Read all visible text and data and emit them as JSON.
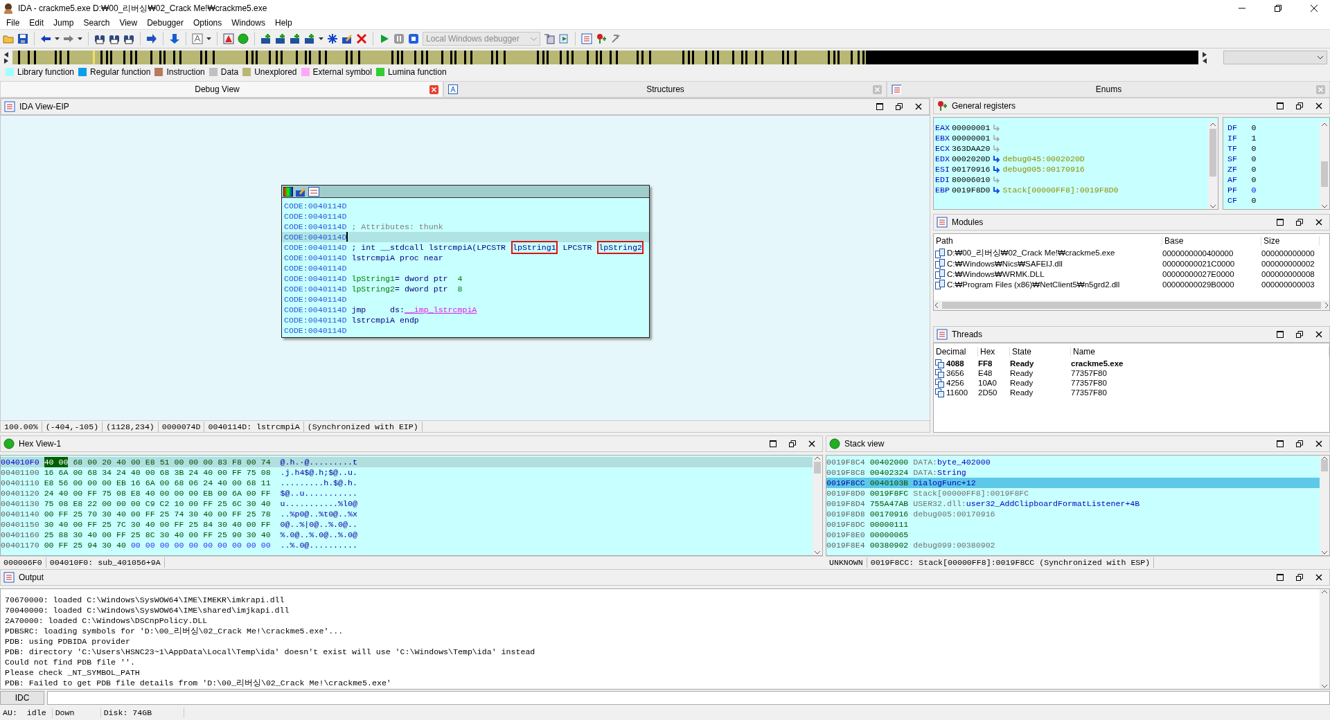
{
  "window": {
    "title": "IDA - crackme5.exe D:₩00_리버싱₩02_Crack Me!₩crackme5.exe"
  },
  "menu": [
    "File",
    "Edit",
    "Jump",
    "Search",
    "View",
    "Debugger",
    "Options",
    "Windows",
    "Help"
  ],
  "toolbar": {
    "debugger": {
      "value": "Local Windows debugger",
      "disabled": true
    }
  },
  "legend": [
    {
      "label": "Library function",
      "color": "#a0ffff"
    },
    {
      "label": "Regular function",
      "color": "#0c9ee6"
    },
    {
      "label": "Instruction",
      "color": "#b57b5c"
    },
    {
      "label": "Data",
      "color": "#c0c0c0"
    },
    {
      "label": "Unexplored",
      "color": "#b8b874"
    },
    {
      "label": "External symbol",
      "color": "#ffa8f8"
    },
    {
      "label": "Lumina function",
      "color": "#33cc33"
    }
  ],
  "tabs": [
    {
      "label": "Debug View",
      "selected": true
    },
    {
      "label": "Structures",
      "selected": false
    },
    {
      "label": "Enums",
      "selected": false
    }
  ],
  "ida_view": {
    "title": "IDA View-EIP",
    "popup": {
      "lines": [
        {
          "address": "CODE:0040114D",
          "selected": false
        },
        {
          "address": "CODE:0040114D",
          "selected": false
        },
        {
          "address": "CODE:0040114D",
          "selected": false,
          "parts": [
            {
              "text": "; Attributes: thunk",
              "kind": "comment"
            }
          ]
        },
        {
          "address": "CODE:0040114D",
          "selected": true
        },
        {
          "address": "CODE:0040114D",
          "selected": false,
          "parts": [
            {
              "text": "; int __stdcall lstrcmpiA(LPCSTR ",
              "kind": "code"
            },
            {
              "text": "lpString1",
              "kind": "boxed"
            },
            {
              "text": " LPCSTR ",
              "kind": "code"
            },
            {
              "text": "lpString2",
              "kind": "boxed"
            }
          ]
        },
        {
          "address": "CODE:0040114D",
          "selected": false,
          "parts": [
            {
              "text": "lstrcmpiA proc near",
              "kind": "code"
            }
          ]
        },
        {
          "address": "CODE:0040114D",
          "selected": false
        },
        {
          "address": "CODE:0040114D",
          "selected": false,
          "parts": [
            {
              "text": "lpString1",
              "kind": "name"
            },
            {
              "text": "= dword ptr  ",
              "kind": "code"
            },
            {
              "text": "4",
              "kind": "number"
            }
          ]
        },
        {
          "address": "CODE:0040114D",
          "selected": false,
          "parts": [
            {
              "text": "lpString2",
              "kind": "name"
            },
            {
              "text": "= dword ptr  ",
              "kind": "code"
            },
            {
              "text": "8",
              "kind": "number"
            }
          ]
        },
        {
          "address": "CODE:0040114D",
          "selected": false
        },
        {
          "address": "CODE:0040114D",
          "selected": false,
          "parts": [
            {
              "text": "jmp     ds:",
              "kind": "code"
            },
            {
              "text": "__imp_lstrcmpiA",
              "kind": "import"
            }
          ]
        },
        {
          "address": "CODE:0040114D",
          "selected": false,
          "parts": [
            {
              "text": "lstrcmpiA endp",
              "kind": "code"
            }
          ]
        },
        {
          "address": "CODE:0040114D",
          "selected": false
        }
      ]
    },
    "status": [
      "100.00%",
      "(-404,-105)",
      "(1128,234)",
      "0000074D",
      "0040114D: lstrcmpiA",
      "(Synchronized with EIP)"
    ]
  },
  "general_registers": {
    "title": "General registers",
    "registers": [
      {
        "name": "EAX",
        "value": "00000001",
        "pointer": false
      },
      {
        "name": "EBX",
        "value": "00000001",
        "pointer": false
      },
      {
        "name": "ECX",
        "value": "363DAA20",
        "pointer": false
      },
      {
        "name": "EDX",
        "value": "0002020D",
        "pointer": true,
        "target": "debug045:0002020D"
      },
      {
        "name": "ESI",
        "value": "00170916",
        "pointer": true,
        "target": "debug005:00170916"
      },
      {
        "name": "EDI",
        "value": "80006010",
        "pointer": false
      },
      {
        "name": "EBP",
        "value": "0019F8D0",
        "pointer": true,
        "target": "Stack[00000FF8]:0019F8D0"
      }
    ],
    "flags": [
      {
        "name": "DF",
        "value": "0",
        "changed": false
      },
      {
        "name": "IF",
        "value": "1",
        "changed": false
      },
      {
        "name": "TF",
        "value": "0",
        "changed": false
      },
      {
        "name": "SF",
        "value": "0",
        "changed": false
      },
      {
        "name": "ZF",
        "value": "0",
        "changed": false
      },
      {
        "name": "AF",
        "value": "0",
        "changed": false
      },
      {
        "name": "PF",
        "value": "0",
        "changed": true
      },
      {
        "name": "CF",
        "value": "0",
        "changed": false
      }
    ]
  },
  "modules": {
    "title": "Modules",
    "columns": [
      "Path",
      "Base",
      "Size"
    ],
    "rows": [
      {
        "path": "D:₩00_리버싱₩02_Crack Me!₩crackme5.exe",
        "base": "0000000000400000",
        "size": "000000000000"
      },
      {
        "path": "C:₩Windows₩Nics₩SAFEIJ.dll",
        "base": "00000000021C0000",
        "size": "000000000002"
      },
      {
        "path": "C:₩Windows₩WRMK.DLL",
        "base": "00000000027E0000",
        "size": "000000000008"
      },
      {
        "path": "C:₩Program Files (x86)₩NetClient5₩n5grd2.dll",
        "base": "00000000029B0000",
        "size": "000000000003"
      }
    ]
  },
  "threads": {
    "title": "Threads",
    "columns": [
      "Decimal",
      "Hex",
      "State",
      "Name"
    ],
    "rows": [
      {
        "decimal": "4088",
        "hex": "FF8",
        "state": "Ready",
        "name": "crackme5.exe",
        "current": true
      },
      {
        "decimal": "3656",
        "hex": "E48",
        "state": "Ready",
        "name": "77357F80",
        "current": false
      },
      {
        "decimal": "4256",
        "hex": "10A0",
        "state": "Ready",
        "name": "77357F80",
        "current": false
      },
      {
        "decimal": "11600",
        "hex": "2D50",
        "state": "Ready",
        "name": "77357F80",
        "current": false
      }
    ]
  },
  "hex_view": {
    "title": "Hex View-1",
    "rows": [
      {
        "address": "004010F0",
        "marked": "40 00",
        "bytes": "68 00 20 40 00 E8 51 00 00 00 83 F8 00 74",
        "ascii": "@.h.·@.........t",
        "selected": true
      },
      {
        "address": "00401100",
        "bytes": "16 6A 00 68 34 24 40 00 68 3B 24 40 00 FF 75 08",
        "ascii": ".j.h4$@.h;$@..u.",
        "selected": false
      },
      {
        "address": "00401110",
        "bytes": "E8 56 00 00 00 EB 16 6A 00 68 06 24 40 00 68 11",
        "ascii": ".........h.$@.h.",
        "selected": false
      },
      {
        "address": "00401120",
        "bytes": "24 40 00 FF 75 08 E8 40 00 00 00 EB 00 6A 00 FF",
        "ascii": "$@..u...........",
        "selected": false
      },
      {
        "address": "00401130",
        "bytes": "75 08 E8 22 00 00 00 C9 C2 10 00 FF 25 6C 30 40",
        "ascii": "u...........%l0@",
        "selected": false
      },
      {
        "address": "00401140",
        "bytes": "00 FF 25 70 30 40 00 FF 25 74 30 40 00 FF 25 78",
        "ascii": "..%p0@..%t0@..%x",
        "selected": false
      },
      {
        "address": "00401150",
        "bytes": "30 40 00 FF 25 7C 30 40 00 FF 25 84 30 40 00 FF",
        "ascii": "0@..%|0@..%.0@..",
        "selected": false
      },
      {
        "address": "00401160",
        "bytes": "25 88 30 40 00 FF 25 8C 30 40 00 FF 25 90 30 40",
        "ascii": "%.0@..%.0@..%.0@",
        "selected": false
      },
      {
        "address": "00401170",
        "bytes": "00 FF 25 94 30 40",
        "unexplored": "00 00 00 00 00 00 00 00 00 00",
        "ascii": "..%.0@..........",
        "selected": false
      }
    ],
    "status": [
      "000006F0",
      "004010F0: sub_401056+9A"
    ]
  },
  "stack_view": {
    "title": "Stack view",
    "rows": [
      {
        "address": "0019F8C4",
        "value": "00402000",
        "comment": "DATA:",
        "symbol": "byte_402000",
        "selected": false
      },
      {
        "address": "0019F8C8",
        "value": "00402324",
        "comment": "DATA:",
        "symbol": "String",
        "selected": false
      },
      {
        "address": "0019F8CC",
        "value": "0040103B",
        "symbol": "DialogFunc+12",
        "selected": true
      },
      {
        "address": "0019F8D0",
        "value": "0019F8FC",
        "comment": "Stack[00000FF8]:0019F8FC",
        "selected": false
      },
      {
        "address": "0019F8D4",
        "value": "755A47AB",
        "comment": "USER32.dll:",
        "symbol": "user32_AddClipboardFormatListener+4B",
        "selected": false
      },
      {
        "address": "0019F8D8",
        "value": "00170916",
        "comment": "debug005:00170916",
        "selected": false
      },
      {
        "address": "0019F8DC",
        "value": "00000111",
        "selected": false
      },
      {
        "address": "0019F8E0",
        "value": "00000065",
        "selected": false
      },
      {
        "address": "0019F8E4",
        "value": "00380902",
        "comment": "debug099:00380902",
        "selected": false
      }
    ],
    "status": [
      "UNKNOWN",
      "0019F8CC: Stack[00000FF8]:0019F8CC (Synchronized with ESP)"
    ]
  },
  "output": {
    "title": "Output",
    "lines": [
      "70670000: loaded C:\\Windows\\SysWOW64\\IME\\IMEKR\\imkrapi.dll",
      "70040000: loaded C:\\Windows\\SysWOW64\\IME\\shared\\imjkapi.dll",
      "2A70000: loaded C:\\Windows\\DSCnpPolicy.DLL",
      "PDBSRC: loading symbols for 'D:\\00_리버싱\\02_Crack Me!\\crackme5.exe'...",
      "PDB: using PDBIDA provider",
      "PDB: directory 'C:\\Users\\HSNC23~1\\AppData\\Local\\Temp\\ida' doesn't exist will use 'C:\\Windows\\Temp\\ida' instead",
      "Could not find PDB file ''.",
      "Please check _NT_SYMBOL_PATH",
      "PDB: Failed to get PDB file details from 'D:\\00_리버싱\\02_Crack Me!\\crackme5.exe'"
    ],
    "command_button": "IDC"
  },
  "status_bar": [
    "AU:  idle",
    "Down",
    "Disk: 74GB"
  ]
}
